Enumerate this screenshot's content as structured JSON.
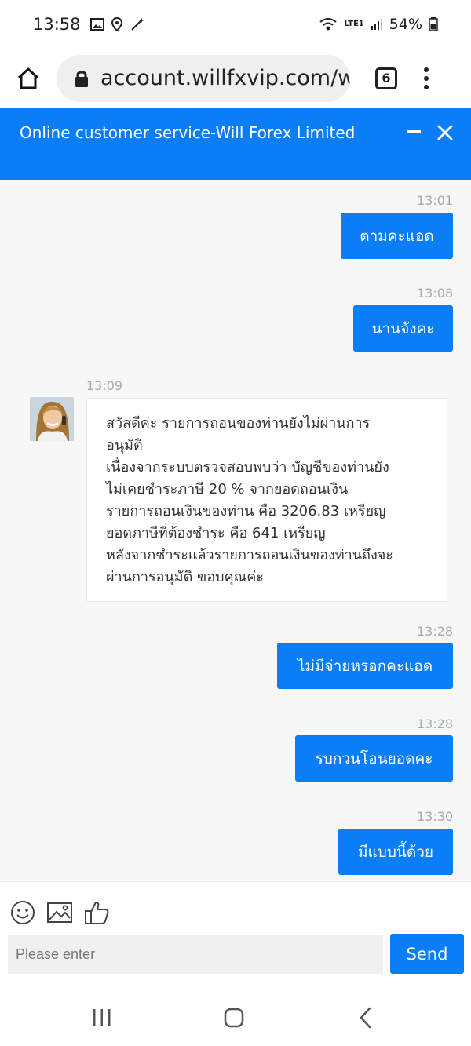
{
  "status_bar": {
    "time": "13:58",
    "battery": "54%",
    "network_label": "LTE1",
    "icons": [
      "gallery-icon",
      "location-icon",
      "magic-wand-icon",
      "wifi-icon",
      "signal-icon",
      "battery-icon"
    ]
  },
  "browser": {
    "url": "account.willfxvip.com/wi",
    "tab_count": "6"
  },
  "chat_header": {
    "title": "Online customer service-Will Forex Limited"
  },
  "messages": {
    "m1": {
      "time": "13:01",
      "text": "ตามคะแอด"
    },
    "m2": {
      "time": "13:08",
      "text": "นานจังคะ"
    },
    "m3": {
      "time": "13:09",
      "lines": [
        "สวัสดีค่ะ รายการถอนของท่านยังไม่ผ่านการ",
        "อนุมัติ",
        "เนื่องจากระบบตรวจสอบพบว่า บัญชีของท่านยัง",
        "ไม่เคยชำระภาษี 20 % จากยอดถอนเงิน",
        "รายการถอนเงินของท่าน คือ 3206.83 เหรียญ",
        "ยอดภาษีที่ต้องชำระ คือ 641 เหรียญ",
        "หลังจากชำระแล้วรายการถอนเงินของท่านถึงจะ",
        "ผ่านการอนุมัติ ขอบคุณค่ะ"
      ]
    },
    "m4": {
      "time": "13:28",
      "text": "ไม่มีจ่ายหรอกคะแอด"
    },
    "m5": {
      "time": "13:28",
      "text": "รบกวนโอนยอดคะ"
    },
    "m6": {
      "time": "13:30",
      "text": "มีแบบนี้ด้วย"
    }
  },
  "input": {
    "placeholder": "Please enter",
    "send_label": "Send"
  },
  "colors": {
    "accent": "#0a7df7",
    "background": "#f7f7f7"
  }
}
